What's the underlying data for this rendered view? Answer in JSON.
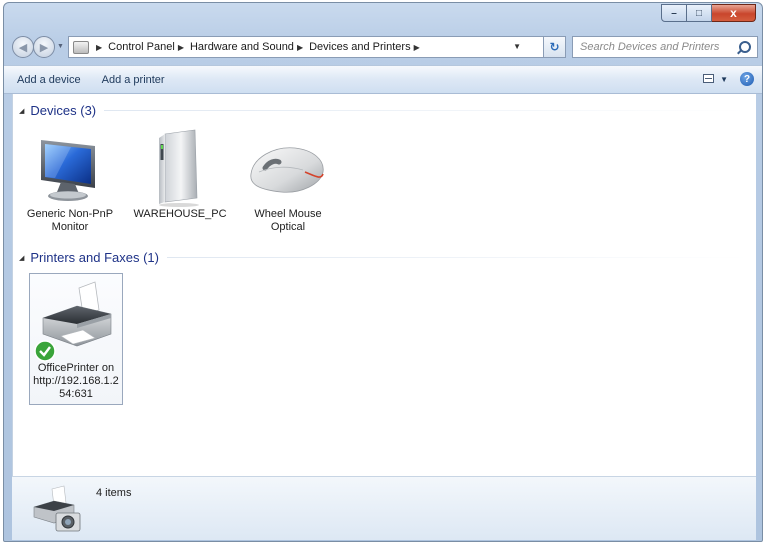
{
  "window": {
    "caption_buttons": {
      "minimize": "–",
      "maximize": "□",
      "close": "x"
    }
  },
  "address": {
    "breadcrumb": [
      "Control Panel",
      "Hardware and Sound",
      "Devices and Printers"
    ],
    "search_placeholder": "Search Devices and Printers"
  },
  "commands": {
    "add_device": "Add a device",
    "add_printer": "Add a printer",
    "help": "?"
  },
  "groups": {
    "devices": {
      "title": "Devices (3)",
      "items": [
        {
          "label_line1": "Generic Non-PnP",
          "label_line2": "Monitor",
          "icon": "monitor-icon"
        },
        {
          "label_line1": "WAREHOUSE_PC",
          "label_line2": "",
          "icon": "computer-tower-icon"
        },
        {
          "label_line1": "Wheel Mouse",
          "label_line2": "Optical",
          "icon": "mouse-icon"
        }
      ]
    },
    "printers": {
      "title": "Printers and Faxes (1)",
      "items": [
        {
          "label_line1": "OfficePrinter on",
          "label_line2": "http://192.168.1.2",
          "label_line3": "54:631",
          "icon": "printer-icon",
          "default_badge": "checkmark-badge-icon"
        }
      ]
    }
  },
  "status": {
    "count": "4 items",
    "icon": "printer-camera-icon"
  },
  "colors": {
    "group_title": "#1e3287",
    "command_text": "#1e395b",
    "close_button": "#c9462c"
  }
}
